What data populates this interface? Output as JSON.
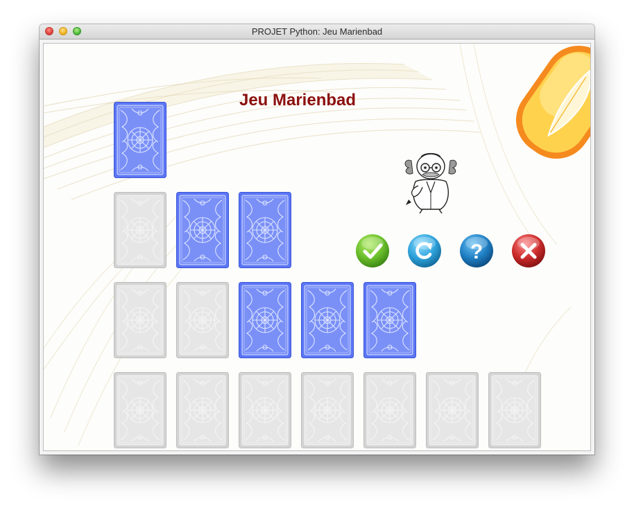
{
  "window": {
    "title": "PROJET Python: Jeu Marienbad"
  },
  "game": {
    "heading": "Jeu Marienbad",
    "rows": [
      {
        "row": 1,
        "cards": [
          "active"
        ]
      },
      {
        "row": 2,
        "cards": [
          "removed",
          "active",
          "active"
        ]
      },
      {
        "row": 3,
        "cards": [
          "removed",
          "removed",
          "active",
          "active",
          "active"
        ]
      },
      {
        "row": 4,
        "cards": [
          "removed",
          "removed",
          "removed",
          "removed",
          "removed",
          "removed",
          "removed"
        ]
      }
    ]
  },
  "colors": {
    "heading": "#8b0f0f",
    "active_card": "#5b76f5",
    "removed_card": "#d4d4d4",
    "validate_button": "#6cc02c",
    "reset_button": "#2fa3dc",
    "help_button": "#1f80c4",
    "quit_button": "#cc2b2b",
    "tag_orange": "#f58a1f",
    "tag_yellow": "#ffd24d"
  },
  "icons": {
    "validate": "check-icon",
    "reset": "refresh-icon",
    "help": "question-icon",
    "quit": "close-icon",
    "character": "professor-icon",
    "tag": "feather-tag-icon"
  }
}
